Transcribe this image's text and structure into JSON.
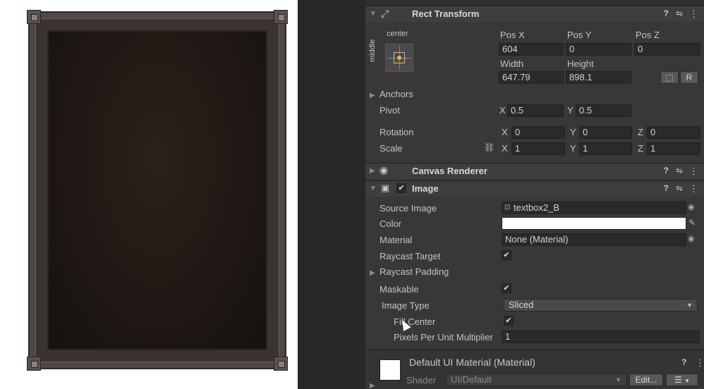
{
  "rect_transform": {
    "title": "Rect Transform",
    "anchor_h": "center",
    "anchor_v": "middle",
    "pos_x_label": "Pos X",
    "pos_y_label": "Pos Y",
    "pos_z_label": "Pos Z",
    "pos_x": "604",
    "pos_y": "0",
    "pos_z": "0",
    "width_label": "Width",
    "height_label": "Height",
    "width": "647.79",
    "height": "898.1",
    "raw_button": "R",
    "anchors_label": "Anchors",
    "pivot_label": "Pivot",
    "pivot_x": "0.5",
    "pivot_y": "0.5",
    "rotation_label": "Rotation",
    "rot_x": "0",
    "rot_y": "0",
    "rot_z": "0",
    "scale_label": "Scale",
    "scale_x": "1",
    "scale_y": "1",
    "scale_z": "1",
    "axis_x": "X",
    "axis_y": "Y",
    "axis_z": "Z"
  },
  "canvas_renderer": {
    "title": "Canvas Renderer"
  },
  "image": {
    "title": "Image",
    "source_image_label": "Source Image",
    "source_image": "textbox2_B",
    "color_label": "Color",
    "color_value": "#ffffff",
    "material_label": "Material",
    "material": "None (Material)",
    "raycast_target_label": "Raycast Target",
    "raycast_padding_label": "Raycast Padding",
    "maskable_label": "Maskable",
    "image_type_label": "Image Type",
    "image_type": "Sliced",
    "fill_center_label": "Fill Center",
    "ppu_label": "Pixels Per Unit Multiplier",
    "ppu": "1"
  },
  "material_panel": {
    "title": "Default UI Material (Material)",
    "shader_label": "Shader",
    "shader": "UI/Default",
    "edit_button": "Edit..."
  },
  "icons": {
    "help": "?",
    "settings": "⇋",
    "more": "⋮",
    "check": "✔",
    "foldout_closed": "▶",
    "foldout_open": "▼",
    "object_picker": "◉",
    "eyedropper": "✎",
    "dropdown": "▼",
    "link": "⛓",
    "eye": "◉",
    "list": "☰"
  }
}
